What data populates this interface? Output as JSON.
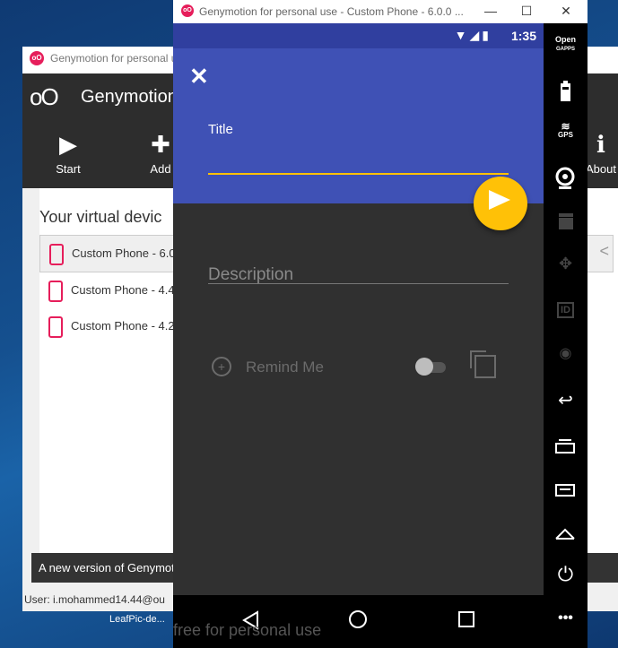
{
  "gm_window": {
    "title": "Genymotion for personal u",
    "logo_text": "oO",
    "brand": "Genymotion",
    "toolbar": [
      {
        "label": "Start",
        "icon": "▶"
      },
      {
        "label": "Add",
        "icon": "✚"
      },
      {
        "label": "About",
        "icon": "ℹ"
      }
    ],
    "heading": "Your virtual devic",
    "devices": [
      {
        "name": "Custom Phone - 6.0"
      },
      {
        "name": "Custom Phone - 4.4"
      },
      {
        "name": "Custom Phone - 4.2"
      }
    ],
    "notice": "A new version of Genymot",
    "status": "User: i.mohammed14.44@ou"
  },
  "desktop": {
    "taskbar_label": "LeafPic-de..."
  },
  "emulator": {
    "title": "Genymotion for personal use - Custom Phone - 6.0.0 ...",
    "window_controls": {
      "minimize": "—",
      "maximize": "☐",
      "close": "✕"
    },
    "status_time": "1:35",
    "watermark": "free for personal use",
    "side_toolbar": [
      {
        "label": "Open\nGAPPS",
        "icon": "open-gapps"
      },
      {
        "label": "",
        "icon": "battery"
      },
      {
        "label": "GPS",
        "icon": "gps"
      },
      {
        "label": "",
        "icon": "webcam"
      },
      {
        "label": "",
        "icon": "clapperboard"
      },
      {
        "label": "",
        "icon": "dpad"
      },
      {
        "label": "ID",
        "icon": "id"
      },
      {
        "label": "",
        "icon": "disk"
      },
      {
        "label": "",
        "icon": "back"
      },
      {
        "label": "",
        "icon": "recent-apps"
      },
      {
        "label": "",
        "icon": "menu"
      },
      {
        "label": "",
        "icon": "home"
      },
      {
        "label": "",
        "icon": "power"
      },
      {
        "label": "•••",
        "icon": "more"
      }
    ]
  },
  "app": {
    "close_icon": "✕",
    "title_label": "Title",
    "description_placeholder": "Description",
    "remind_label": "Remind Me",
    "remind_enabled": false,
    "colors": {
      "primary_dark": "#303f9f",
      "primary": "#3f51b5",
      "accent": "#ffc107",
      "background": "#303030"
    }
  }
}
